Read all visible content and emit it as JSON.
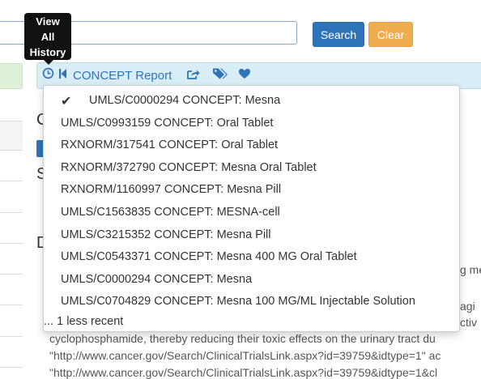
{
  "search": {
    "button_label": "Search",
    "clear_label": "Clear"
  },
  "tooltip": {
    "line1": "View",
    "line2": "All",
    "line3": "History"
  },
  "toolbar": {
    "title": "CONCEPT Report",
    "icons": [
      "history-clock-icon",
      "step-backward-icon",
      "share-icon",
      "tags-icon",
      "heart-icon"
    ]
  },
  "background": {
    "heading_c": "C",
    "heading_s": "S",
    "heading_d": "D",
    "line_1": "g me",
    "line_2": "agi",
    "line_3": "ctiv",
    "line_4": "cyclophosphamide, thereby reducing their toxic effects on the urinary tract du",
    "line_5": "\"http://www.cancer.gov/Search/ClinicalTrialsLink.aspx?id=39759&idtype=1\" ac",
    "line_6": "\"http://www.cancer.gov/Search/ClinicalTrialsLink.aspx?id=39759&idtype=1&cl"
  },
  "history_menu": {
    "items": [
      {
        "label": "UMLS/C0000294 CONCEPT: Mesna",
        "checked": true
      },
      {
        "label": "UMLS/C0993159 CONCEPT: Oral Tablet",
        "checked": false
      },
      {
        "label": "RXNORM/317541 CONCEPT: Oral Tablet",
        "checked": false
      },
      {
        "label": "RXNORM/372790 CONCEPT: Mesna Oral Tablet",
        "checked": false
      },
      {
        "label": "RXNORM/1160997 CONCEPT: Mesna Pill",
        "checked": false
      },
      {
        "label": "UMLS/C1563835 CONCEPT: MESNA-cell",
        "checked": false
      },
      {
        "label": "UMLS/C3215352 CONCEPT: Mesna Pill",
        "checked": false
      },
      {
        "label": "UMLS/C0543371 CONCEPT: Mesna 400 MG Oral Tablet",
        "checked": false
      },
      {
        "label": "UMLS/C0000294 CONCEPT: Mesna",
        "checked": false
      },
      {
        "label": "UMLS/C0704829 CONCEPT: Mesna 100 MG/ML Injectable Solution",
        "checked": false
      }
    ],
    "footer": "... 1 less recent"
  },
  "colors": {
    "primary": "#2d74b8",
    "warning": "#f0ad4e",
    "toolbar_bg": "#d9edf7",
    "success_bg": "#dff0d8"
  }
}
